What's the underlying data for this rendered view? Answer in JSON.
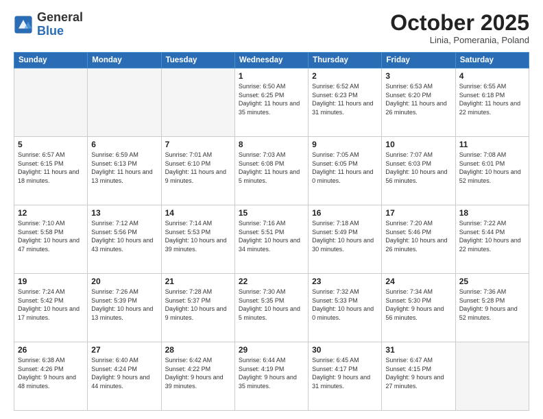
{
  "header": {
    "logo_general": "General",
    "logo_blue": "Blue",
    "month_title": "October 2025",
    "subtitle": "Linia, Pomerania, Poland"
  },
  "days_of_week": [
    "Sunday",
    "Monday",
    "Tuesday",
    "Wednesday",
    "Thursday",
    "Friday",
    "Saturday"
  ],
  "weeks": [
    [
      {
        "day": "",
        "empty": true
      },
      {
        "day": "",
        "empty": true
      },
      {
        "day": "",
        "empty": true
      },
      {
        "day": "1",
        "sunrise": "6:50 AM",
        "sunset": "6:25 PM",
        "daylight": "11 hours and 35 minutes."
      },
      {
        "day": "2",
        "sunrise": "6:52 AM",
        "sunset": "6:23 PM",
        "daylight": "11 hours and 31 minutes."
      },
      {
        "day": "3",
        "sunrise": "6:53 AM",
        "sunset": "6:20 PM",
        "daylight": "11 hours and 26 minutes."
      },
      {
        "day": "4",
        "sunrise": "6:55 AM",
        "sunset": "6:18 PM",
        "daylight": "11 hours and 22 minutes."
      }
    ],
    [
      {
        "day": "5",
        "sunrise": "6:57 AM",
        "sunset": "6:15 PM",
        "daylight": "11 hours and 18 minutes."
      },
      {
        "day": "6",
        "sunrise": "6:59 AM",
        "sunset": "6:13 PM",
        "daylight": "11 hours and 13 minutes."
      },
      {
        "day": "7",
        "sunrise": "7:01 AM",
        "sunset": "6:10 PM",
        "daylight": "11 hours and 9 minutes."
      },
      {
        "day": "8",
        "sunrise": "7:03 AM",
        "sunset": "6:08 PM",
        "daylight": "11 hours and 5 minutes."
      },
      {
        "day": "9",
        "sunrise": "7:05 AM",
        "sunset": "6:05 PM",
        "daylight": "11 hours and 0 minutes."
      },
      {
        "day": "10",
        "sunrise": "7:07 AM",
        "sunset": "6:03 PM",
        "daylight": "10 hours and 56 minutes."
      },
      {
        "day": "11",
        "sunrise": "7:08 AM",
        "sunset": "6:01 PM",
        "daylight": "10 hours and 52 minutes."
      }
    ],
    [
      {
        "day": "12",
        "sunrise": "7:10 AM",
        "sunset": "5:58 PM",
        "daylight": "10 hours and 47 minutes."
      },
      {
        "day": "13",
        "sunrise": "7:12 AM",
        "sunset": "5:56 PM",
        "daylight": "10 hours and 43 minutes."
      },
      {
        "day": "14",
        "sunrise": "7:14 AM",
        "sunset": "5:53 PM",
        "daylight": "10 hours and 39 minutes."
      },
      {
        "day": "15",
        "sunrise": "7:16 AM",
        "sunset": "5:51 PM",
        "daylight": "10 hours and 34 minutes."
      },
      {
        "day": "16",
        "sunrise": "7:18 AM",
        "sunset": "5:49 PM",
        "daylight": "10 hours and 30 minutes."
      },
      {
        "day": "17",
        "sunrise": "7:20 AM",
        "sunset": "5:46 PM",
        "daylight": "10 hours and 26 minutes."
      },
      {
        "day": "18",
        "sunrise": "7:22 AM",
        "sunset": "5:44 PM",
        "daylight": "10 hours and 22 minutes."
      }
    ],
    [
      {
        "day": "19",
        "sunrise": "7:24 AM",
        "sunset": "5:42 PM",
        "daylight": "10 hours and 17 minutes."
      },
      {
        "day": "20",
        "sunrise": "7:26 AM",
        "sunset": "5:39 PM",
        "daylight": "10 hours and 13 minutes."
      },
      {
        "day": "21",
        "sunrise": "7:28 AM",
        "sunset": "5:37 PM",
        "daylight": "10 hours and 9 minutes."
      },
      {
        "day": "22",
        "sunrise": "7:30 AM",
        "sunset": "5:35 PM",
        "daylight": "10 hours and 5 minutes."
      },
      {
        "day": "23",
        "sunrise": "7:32 AM",
        "sunset": "5:33 PM",
        "daylight": "10 hours and 0 minutes."
      },
      {
        "day": "24",
        "sunrise": "7:34 AM",
        "sunset": "5:30 PM",
        "daylight": "9 hours and 56 minutes."
      },
      {
        "day": "25",
        "sunrise": "7:36 AM",
        "sunset": "5:28 PM",
        "daylight": "9 hours and 52 minutes."
      }
    ],
    [
      {
        "day": "26",
        "sunrise": "6:38 AM",
        "sunset": "4:26 PM",
        "daylight": "9 hours and 48 minutes."
      },
      {
        "day": "27",
        "sunrise": "6:40 AM",
        "sunset": "4:24 PM",
        "daylight": "9 hours and 44 minutes."
      },
      {
        "day": "28",
        "sunrise": "6:42 AM",
        "sunset": "4:22 PM",
        "daylight": "9 hours and 39 minutes."
      },
      {
        "day": "29",
        "sunrise": "6:44 AM",
        "sunset": "4:19 PM",
        "daylight": "9 hours and 35 minutes."
      },
      {
        "day": "30",
        "sunrise": "6:45 AM",
        "sunset": "4:17 PM",
        "daylight": "9 hours and 31 minutes."
      },
      {
        "day": "31",
        "sunrise": "6:47 AM",
        "sunset": "4:15 PM",
        "daylight": "9 hours and 27 minutes."
      },
      {
        "day": "",
        "empty": true
      }
    ]
  ]
}
